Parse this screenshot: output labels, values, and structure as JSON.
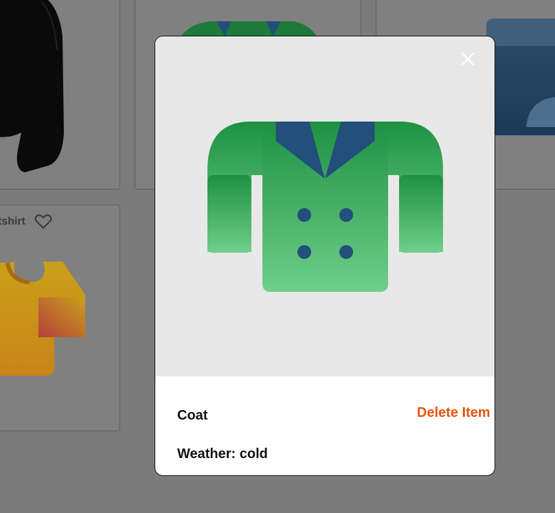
{
  "background_cards": [
    {
      "name": "black-sweater-card"
    },
    {
      "name": "green-coat-card"
    },
    {
      "name": "blue-item-card"
    },
    {
      "name": "yellow-tshirt-card",
      "label_visible": "tshirt"
    }
  ],
  "modal": {
    "item_name": "Coat",
    "delete_label": "Delete Item",
    "weather_label": "Weather:",
    "weather_value": "cold",
    "close_icon": "close-icon",
    "image_icon": "coat-icon"
  },
  "colors": {
    "coat_green_top": "#1e9142",
    "coat_green_bottom": "#6fcf8a",
    "coat_blue": "#234f7b",
    "delete_orange": "#e8540e",
    "image_bg": "#e8e8e8",
    "backdrop": "#7b7b7b"
  }
}
